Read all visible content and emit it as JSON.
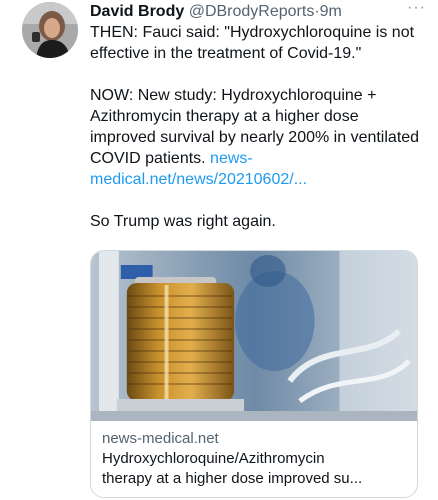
{
  "author": {
    "display_name": "David Brody",
    "handle": "@DBrodyReports",
    "separator": "·",
    "time": "9m"
  },
  "more_label": "···",
  "tweet": {
    "para1": "THEN: Fauci said: \"Hydroxychloroquine is not effective in the treatment of Covid-19.\"",
    "para2_text": "NOW: New study: Hydroxychloroquine + Azithromycin therapy at a higher dose improved survival by nearly 200% in ventilated COVID patients. ",
    "para2_link": "news-medical.net/news/20210602/...",
    "para3": "So Trump was right again."
  },
  "card": {
    "domain": "news-medical.net",
    "title_line1": "Hydroxychloroquine/Azithromycin",
    "title_line2": "therapy at a higher dose improved su..."
  },
  "colors": {
    "text": "#0f1419",
    "muted": "#536471",
    "link": "#1d9bf0",
    "border": "#cfd9de"
  },
  "icons": {
    "avatar": "user-avatar",
    "more": "more-dots-icon"
  }
}
